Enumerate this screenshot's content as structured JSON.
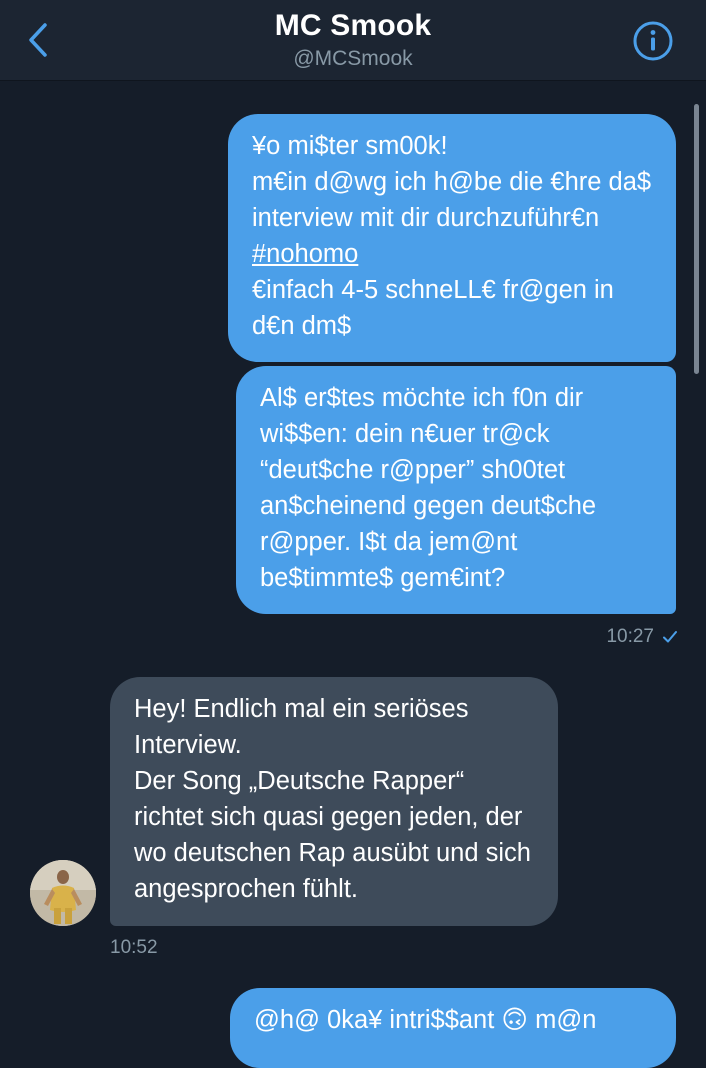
{
  "header": {
    "title": "MC Smook",
    "handle": "@MCSmook"
  },
  "messages": [
    {
      "direction": "outgoing",
      "text_before_hashtag": "¥o mi$ter sm00k!\nm€in d@wg ich h@be die €hre da$ interview mit dir durchzuführ€n ",
      "hashtag": "#nohomo",
      "text_after_hashtag": "\n€infach 4-5 schneLL€ fr@gen in d€n dm$"
    },
    {
      "direction": "outgoing",
      "text": "Al$ er$tes möchte ich f0n dir wi$$en: dein n€uer tr@ck “deut$che r@pper” sh00tet an$cheinend gegen deut$che r@pper. I$t da jem@nt be$timmte$ gem€int?",
      "time": "10:27",
      "status_icon": "checkmark-icon"
    },
    {
      "direction": "incoming",
      "text": "Hey! Endlich mal ein seriöses Interview.\nDer Song „Deutsche Rapper“ richtet sich quasi gegen jeden, der wo deutschen Rap ausübt und sich angesprochen fühlt.",
      "time": "10:52"
    },
    {
      "direction": "outgoing",
      "text": "@h@ 0ka¥ intri$$ant 🙃 m@n"
    }
  ],
  "colors": {
    "background": "#151d29",
    "header": "#1c2532",
    "outgoing_bubble": "#4b9fe9",
    "incoming_bubble": "#3e4b5a",
    "accent": "#4b9fe9",
    "meta_text": "#8899a6"
  },
  "icons": {
    "back": "chevron-left-icon",
    "info": "info-icon",
    "read": "checkmark-icon"
  }
}
